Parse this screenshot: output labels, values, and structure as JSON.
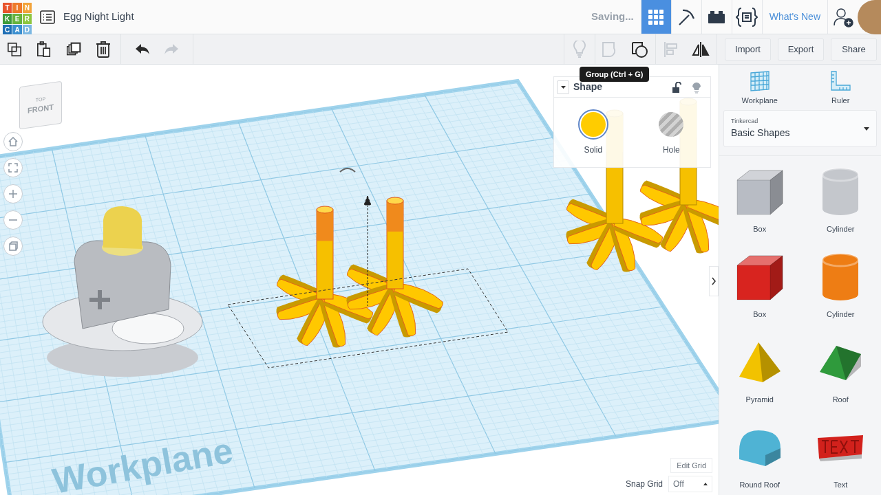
{
  "logo": {
    "tiles": [
      {
        "letter": "T",
        "color": "#e8542c"
      },
      {
        "letter": "I",
        "color": "#ee7a2b"
      },
      {
        "letter": "N",
        "color": "#f2a33a"
      },
      {
        "letter": "K",
        "color": "#3f9b3a"
      },
      {
        "letter": "E",
        "color": "#67b33d"
      },
      {
        "letter": "R",
        "color": "#8dc63f"
      },
      {
        "letter": "C",
        "color": "#1f6fb5"
      },
      {
        "letter": "A",
        "color": "#3b8fd0"
      },
      {
        "letter": "D",
        "color": "#7bb7e2"
      }
    ]
  },
  "design": {
    "title": "Egg Night Light"
  },
  "status": "Saving...",
  "nav_tabs": [
    {
      "kind": "grid",
      "selected": true
    },
    {
      "kind": "pickaxe",
      "selected": false
    },
    {
      "kind": "brick",
      "selected": false
    },
    {
      "kind": "code",
      "selected": false
    }
  ],
  "whats_new": "What's New",
  "edit_tools": [
    {
      "kind": "copy",
      "disabled": false
    },
    {
      "kind": "paste",
      "disabled": false
    },
    {
      "kind": "duplicate",
      "disabled": false
    },
    {
      "kind": "delete",
      "disabled": false
    },
    {
      "kind": "undo",
      "disabled": false
    },
    {
      "kind": "redo",
      "disabled": true
    }
  ],
  "shape_tools": [
    {
      "kind": "bulb",
      "disabled": true
    },
    {
      "kind": "ungroup",
      "disabled": true
    },
    {
      "kind": "group",
      "disabled": false
    },
    {
      "kind": "align",
      "disabled": true
    },
    {
      "kind": "mirror",
      "disabled": false
    }
  ],
  "actions": [
    "Import",
    "Export",
    "Share"
  ],
  "tooltip": "Group (Ctrl + G)",
  "view_cube": {
    "top": "TOP",
    "front": "FRONT"
  },
  "inspector": {
    "title": "Shape",
    "options": [
      {
        "label": "Solid",
        "kind": "solid",
        "selected": true
      },
      {
        "label": "Hole",
        "kind": "hole",
        "selected": false
      }
    ]
  },
  "workplane_label": "Workplane",
  "edit_grid": "Edit Grid",
  "snap_grid": {
    "label": "Snap Grid",
    "value": "Off"
  },
  "panel": {
    "tools": [
      {
        "label": "Workplane",
        "kind": "workplane"
      },
      {
        "label": "Ruler",
        "kind": "ruler"
      }
    ],
    "library": {
      "source": "Tinkercad",
      "name": "Basic Shapes"
    },
    "shapes": [
      {
        "label": "Box",
        "kind": "box",
        "color": "#b8bcc4"
      },
      {
        "label": "Cylinder",
        "kind": "cylinder",
        "color": "#c4c7cc"
      },
      {
        "label": "Box",
        "kind": "box",
        "color": "#d8241f"
      },
      {
        "label": "Cylinder",
        "kind": "cylinder",
        "color": "#ee7d14"
      },
      {
        "label": "Pyramid",
        "kind": "pyramid",
        "color": "#f2c200"
      },
      {
        "label": "Roof",
        "kind": "roof",
        "color": "#2f9a3c"
      },
      {
        "label": "Round Roof",
        "kind": "roundroof",
        "color": "#4fb3d4"
      },
      {
        "label": "Text",
        "kind": "text",
        "color": "#d2211c"
      }
    ]
  }
}
